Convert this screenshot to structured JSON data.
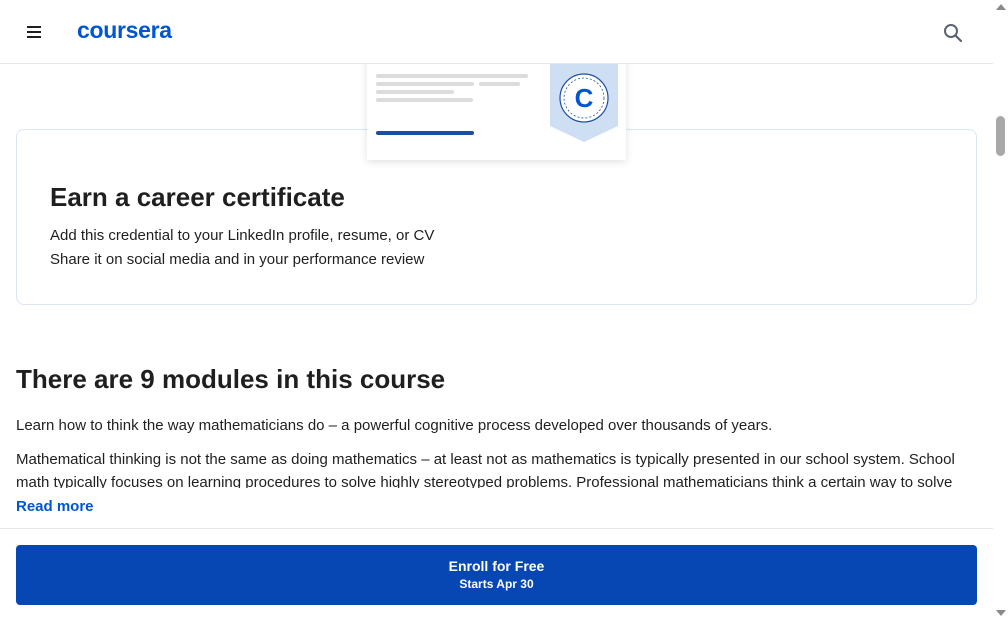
{
  "header": {
    "logo_text": "coursera",
    "menu_icon": "hamburger-menu-icon",
    "search_icon": "search-icon",
    "brand_color": "#0056d2"
  },
  "certificate": {
    "badge_letter": "C",
    "title": "Earn a career certificate",
    "line1": "Add this credential to your LinkedIn profile, resume, or CV",
    "line2": "Share it on social media and in your performance review"
  },
  "modules": {
    "title": "There are 9 modules in this course",
    "paragraph1": "Learn how to think the way mathematicians do – a powerful cognitive process developed over thousands of years.",
    "paragraph2": "Mathematical thinking is not the same as doing mathematics – at least not as mathematics is typically presented in our school system. School math typically focuses on learning procedures to solve highly stereotyped problems. Professional mathematicians think a certain way to solve",
    "read_more": "Read more"
  },
  "enroll": {
    "label": "Enroll for Free",
    "sub_label": "Starts Apr 30",
    "button_color": "#0747b4"
  }
}
